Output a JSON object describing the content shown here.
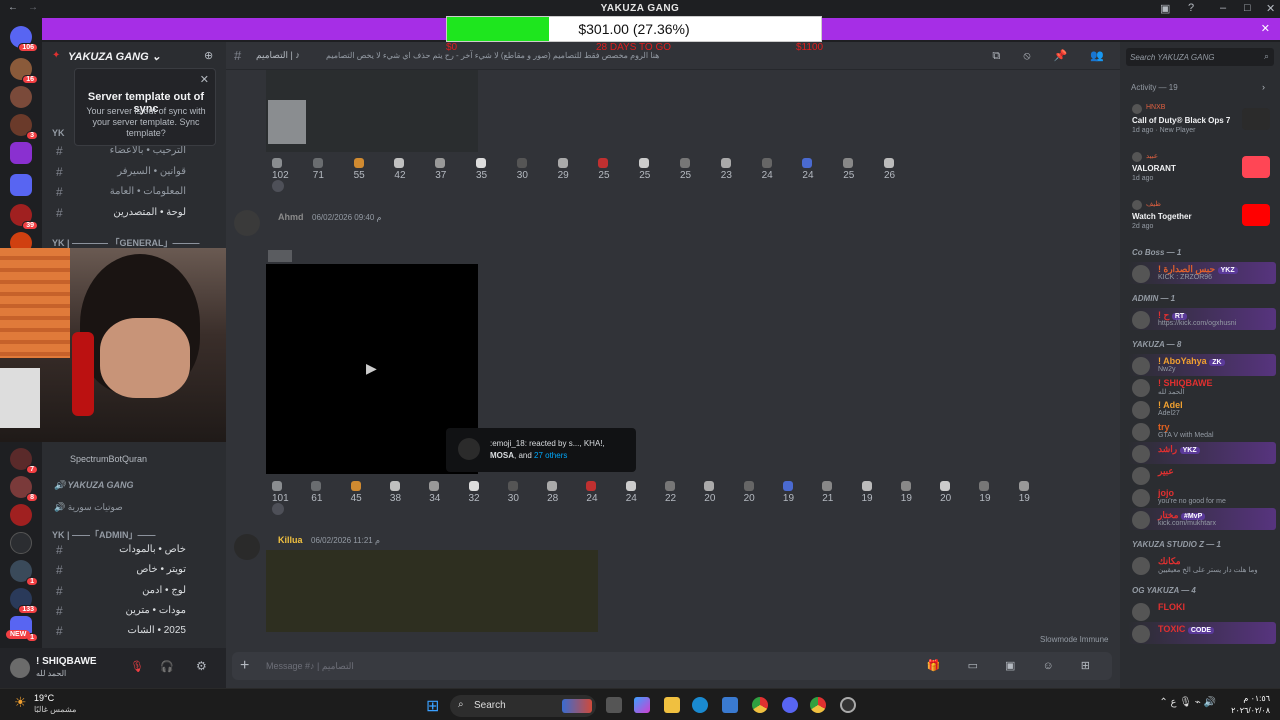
{
  "window": {
    "title": "YAKUZA GANG"
  },
  "goal": {
    "amount_text": "$301.00 (27.36%)",
    "progress": 0.2736,
    "start_label": "$0",
    "days_label": "28 DAYS TO GO",
    "end_label": "$1100"
  },
  "guilds": {
    "badges": [
      "106",
      "16",
      "3",
      "39",
      "7",
      "8",
      "1",
      "133",
      "1",
      "NEW"
    ]
  },
  "server": {
    "name": "YAKUZA GANG",
    "tooltip": {
      "title": "Server template out of sync",
      "body": "Your server is out of sync with your server template. Sync template?"
    },
    "categories": {
      "yk": "YK",
      "general": "YK | ———— 「GENERAL」———",
      "admin": "YK | ——「ADMIN」——"
    },
    "channels_top": [
      "الترحيب • بالاعضاء",
      "قوانين • السيرفر",
      "المعلومات • العامة",
      "لوحة • المتصدرين"
    ],
    "voice": [
      {
        "label": "SpectrumBotQuran"
      },
      {
        "label": "YAKUZA GANG"
      },
      {
        "label": "صوتيات سورية"
      }
    ],
    "channels_admin": [
      "خاص • بالمودات",
      "تويتر • خاص",
      "لوج • ادمن",
      "مودات • مترين",
      "2025 • الشات"
    ]
  },
  "user": {
    "name": "! SHIQBAWE",
    "status": "الحمد لله"
  },
  "channel": {
    "name": "التصاميم | ♪",
    "topic": "هنا الروم مخصص فقط للتصاميم (صور و مقاطع) لا شيء آخر - رح يتم حذف اي شيء لا يخص التصاميم"
  },
  "messages": [
    {
      "reactions": [
        "102",
        "71",
        "55",
        "42",
        "37",
        "35",
        "30",
        "29",
        "25",
        "25",
        "25",
        "23",
        "24",
        "24",
        "25",
        "26"
      ]
    },
    {
      "author": "Ahmd",
      "timestamp": "06/02/2026 09:40 م",
      "reactions": [
        "101",
        "61",
        "45",
        "38",
        "34",
        "32",
        "30",
        "28",
        "24",
        "24",
        "22",
        "20",
        "20",
        "19",
        "21",
        "19",
        "19",
        "20",
        "19",
        "19"
      ],
      "tooltip": {
        "line1": ":emoji_18: reacted by s..., KHA!,",
        "bold": "MOSA",
        "and": ", and ",
        "others": "27 others"
      }
    },
    {
      "author": "Killua",
      "timestamp": "06/02/2026 11:21 م"
    }
  ],
  "composer": {
    "placeholder": "Message #♪ | التصاميم",
    "slowmode": "Slowmode Immune"
  },
  "members_panel": {
    "search_placeholder": "Search YAKUZA GANG",
    "activity_title": "Activity — 19",
    "activities": [
      {
        "user": "HNXB",
        "name": "Call of Duty® Black Ops 7",
        "sub": "1d ago  ·  New Player",
        "color": "#2b2b2b"
      },
      {
        "user": "عبيد",
        "name": "VALORANT",
        "sub": "1d ago",
        "color": "#ff4655"
      },
      {
        "user": "ظيف",
        "name": "Watch Together",
        "sub": "2d ago",
        "color": "#ff0000"
      }
    ],
    "groups": [
      {
        "title": "Co Boss — 1",
        "members": [
          {
            "name": "! حبس الصدارة",
            "sub": "KICK : ZRZOR96",
            "tag": "YKZ",
            "color": "#e0602d"
          }
        ]
      },
      {
        "title": "ADMIN — 1",
        "members": [
          {
            "name": "! ح",
            "sub": "https://kick.com/ogxhusni",
            "tag": "RT",
            "color": "#e03030"
          }
        ]
      },
      {
        "title": "YAKUZA — 8",
        "members": [
          {
            "name": "! AboYahya",
            "sub": "Nw2y",
            "tag": "ZK",
            "color": "#f0a030"
          },
          {
            "name": "! SHIQBAWE",
            "sub": "الحمد لله",
            "tag": "",
            "color": "#e03030"
          },
          {
            "name": "! Adel",
            "sub": "Adel27",
            "tag": "",
            "color": "#f0a030"
          },
          {
            "name": "try",
            "sub": "GTA V with Medal",
            "tag": "",
            "color": "#e06020"
          },
          {
            "name": "راشد",
            "sub": "",
            "tag": "YKZ",
            "color": "#e03030"
          },
          {
            "name": "عبير",
            "sub": "",
            "tag": "",
            "color": "#e03030"
          },
          {
            "name": "jojo",
            "sub": "you're no good for me",
            "tag": "",
            "color": "#e03030"
          },
          {
            "name": "مختار",
            "sub": "kick.com/mukhtarx",
            "tag": "#MvP",
            "color": "#e03030"
          }
        ]
      },
      {
        "title": "YAKUZA STUDIO Z — 1",
        "members": [
          {
            "name": "مكانك",
            "sub": "وما هلت دار يستر على الخ معيقيين",
            "tag": "",
            "color": "#e03030"
          }
        ]
      },
      {
        "title": "OG YAKUZA — 4",
        "members": [
          {
            "name": "FLOKI",
            "sub": "",
            "tag": "",
            "color": "#e03030"
          },
          {
            "name": "TOXIC",
            "sub": "",
            "tag": "CODE",
            "color": "#e03030"
          }
        ]
      }
    ]
  },
  "taskbar": {
    "temp": "19°C",
    "condition": "مشمس غالبًا",
    "search": "Search",
    "time": "٠١:٥٦ م",
    "date": "٢٠٢٦/٠٢/٠٨"
  },
  "colors": {
    "accent": "#a62ee6",
    "progress_fill": "#1ee61e",
    "bg": "#313338"
  }
}
